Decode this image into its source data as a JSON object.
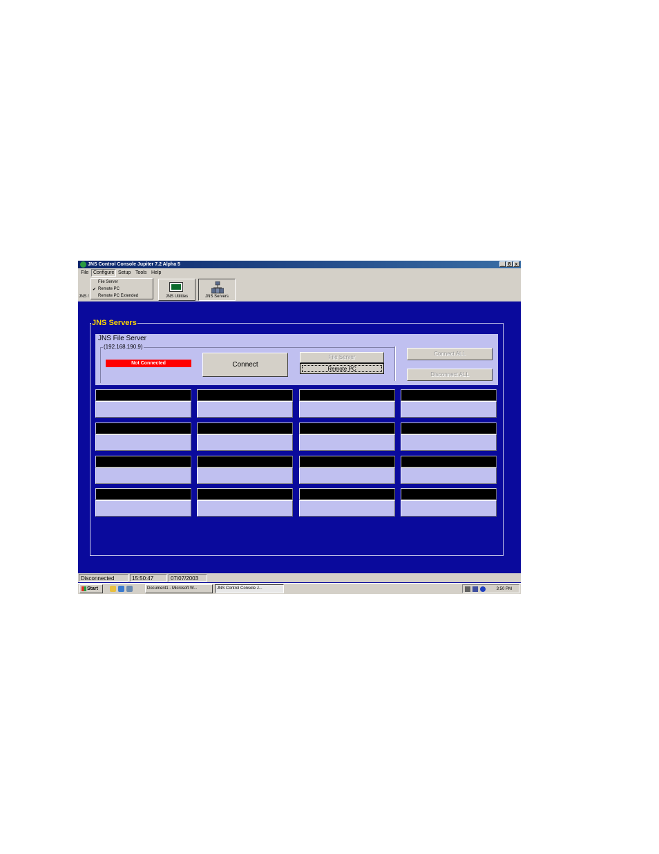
{
  "window": {
    "title": "JNS Control Console  Jupiter 7.2 Alpha 5",
    "controls": [
      "_",
      "8",
      "x"
    ]
  },
  "menubar": {
    "items": [
      "File",
      "Configure",
      "Setup",
      "Tools",
      "Help"
    ],
    "active": "Configure"
  },
  "configure_menu": {
    "items": [
      {
        "label": "File Server",
        "checked": false
      },
      {
        "label": "Remote PC",
        "checked": true
      },
      {
        "label": "Remote PC Extended",
        "checked": false
      }
    ],
    "check_glyph": "✔"
  },
  "toolbar": {
    "partial_label": "JNS /",
    "buttons": [
      {
        "label": "JNS Utilities",
        "icon": "monitor-icon",
        "pressed": false
      },
      {
        "label": "JNS Servers",
        "icon": "servers-icon",
        "pressed": true
      }
    ]
  },
  "main": {
    "group_title": "JNS Servers",
    "file_server": {
      "title": "JNS File Server",
      "ip": "(192.168.190.9)",
      "status": "Not Connected",
      "status_color": "#ff0000",
      "connect_label": "Connect",
      "file_server_label": "File Server",
      "remote_pc_label": "Remote PC",
      "connect_all_label": "Connect ALL",
      "disconnect_all_label": "Disconnect ALL"
    },
    "slots": [
      {
        "id": "s1"
      },
      {
        "id": "s2"
      },
      {
        "id": "s3"
      },
      {
        "id": "s4"
      },
      {
        "id": "s5"
      },
      {
        "id": "s6"
      },
      {
        "id": "s7"
      },
      {
        "id": "s8"
      },
      {
        "id": "s9"
      },
      {
        "id": "s10"
      },
      {
        "id": "s11"
      },
      {
        "id": "s12"
      },
      {
        "id": "s13"
      },
      {
        "id": "s14"
      },
      {
        "id": "s15"
      },
      {
        "id": "s16"
      }
    ]
  },
  "statusbar": {
    "state": "Disconnected",
    "time": "15:50:47",
    "date": "07/07/2003"
  },
  "taskbar": {
    "start_label": "Start",
    "tasks": [
      {
        "label": "Document1 - Microsoft W...",
        "active": false
      },
      {
        "label": "JNS Control Console   J...",
        "active": true
      }
    ],
    "clock": "3:50 PM"
  },
  "colors": {
    "background": "#0a0a9c",
    "panel": "#c0c0f0",
    "group_title": "#ffd800"
  }
}
